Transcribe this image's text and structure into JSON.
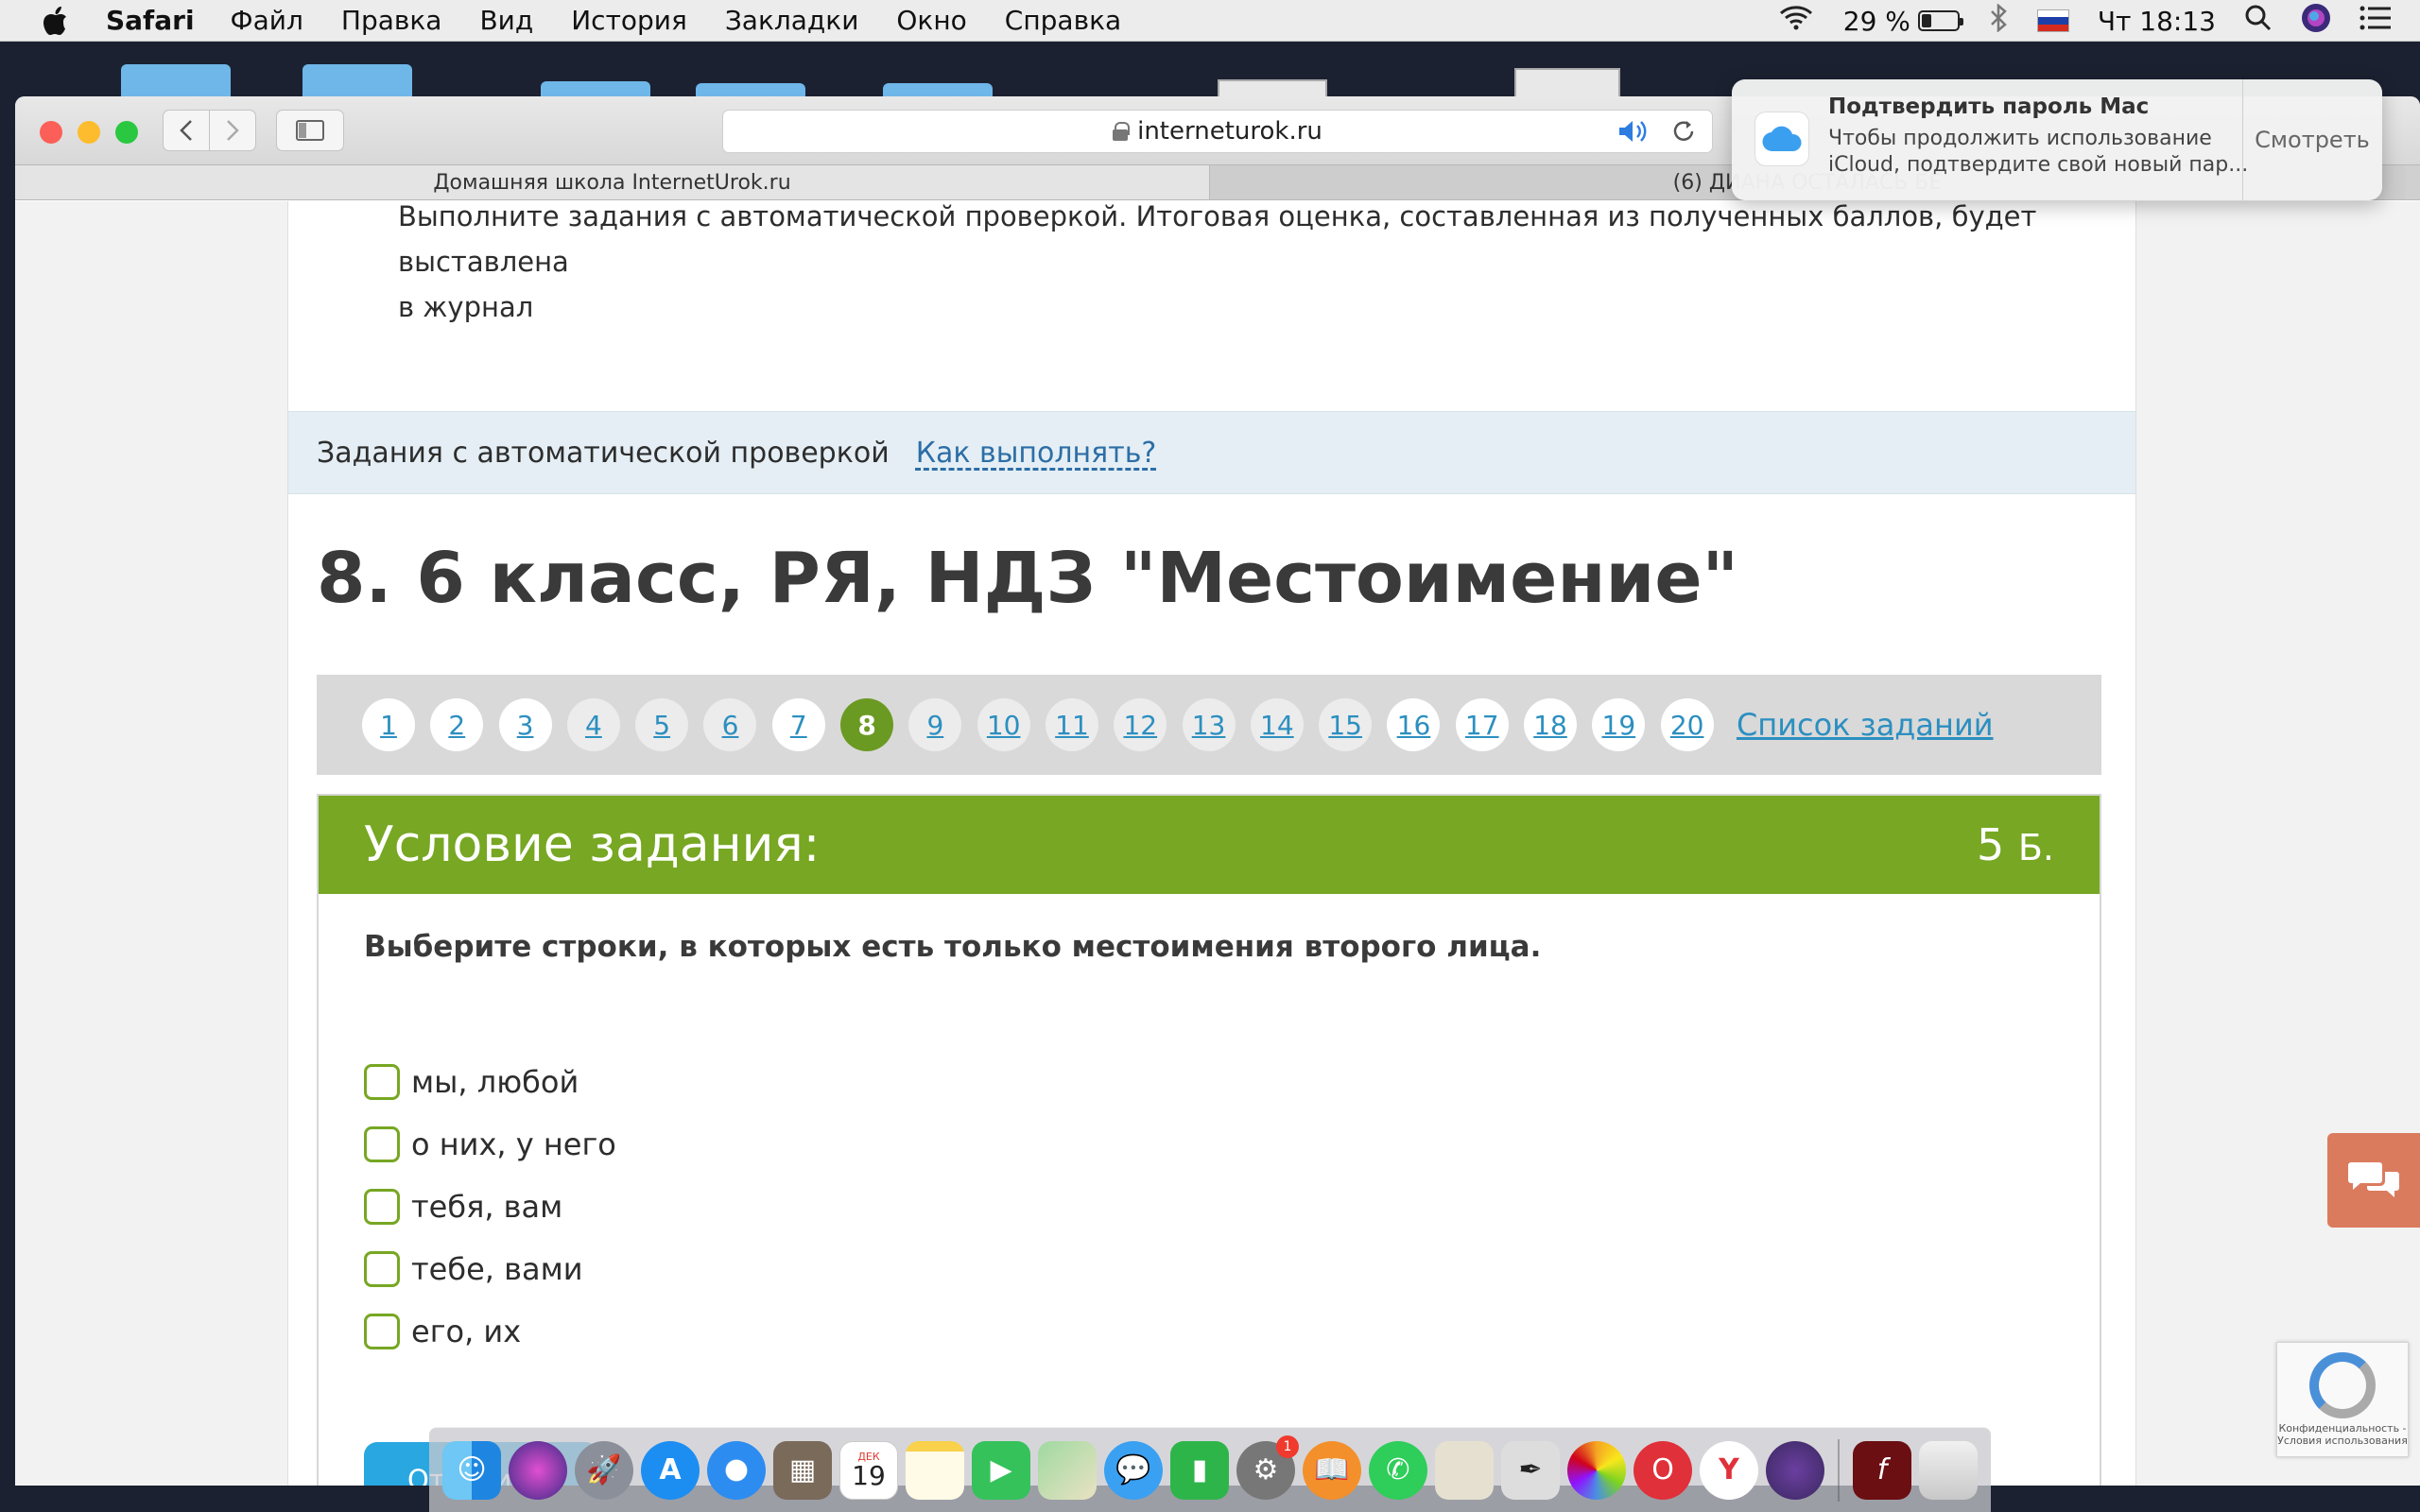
{
  "menubar": {
    "app": "Safari",
    "items": [
      "Файл",
      "Правка",
      "Вид",
      "История",
      "Закладки",
      "Окно",
      "Справка"
    ],
    "battery": "29 %",
    "battery_level": 0.29,
    "clock": "Чт 18:13"
  },
  "browser": {
    "url": "interneturok.ru",
    "tabs": [
      {
        "label": "Домашняя школа InternetUrok.ru"
      },
      {
        "label": "(6) ДИАНА ОСТАЛАСЬ БЕ"
      }
    ]
  },
  "notification": {
    "title": "Подтвердить пароль Mac",
    "line1": "Чтобы продолжить использование",
    "line2": "iCloud, подтвердите свой новый пар...",
    "action": "Смотреть"
  },
  "page": {
    "intro_line1": "Выполните задания с автоматической проверкой. Итоговая оценка, составленная из полученных баллов, будет выставлена",
    "intro_line2": "в журнал",
    "auto_label": "Задания с автоматической проверкой",
    "how_link": "Как выполнять?",
    "title": "8. 6 класс, РЯ, НДЗ \"Местоимение\"",
    "pager": {
      "pages": [
        "1",
        "2",
        "3",
        "4",
        "5",
        "6",
        "7",
        "8",
        "9",
        "10",
        "11",
        "12",
        "13",
        "14",
        "15",
        "16",
        "17",
        "18",
        "19",
        "20"
      ],
      "current": "8",
      "list_link": "Список заданий"
    },
    "task": {
      "header": "Условие задания:",
      "points": "5",
      "points_unit": "Б.",
      "question": "Выберите строки, в которых есть только местоимения второго лица.",
      "options": [
        "мы, любой",
        "о них, у него",
        "тебя, вам",
        "тебе, вами",
        "его, их"
      ],
      "submit": "Ответить!"
    },
    "recaptcha_text": "Конфиденциальность - Условия использования"
  },
  "dock": {
    "calendar_month": "ДЕК",
    "calendar_day": "19",
    "prefs_badge": "1"
  }
}
